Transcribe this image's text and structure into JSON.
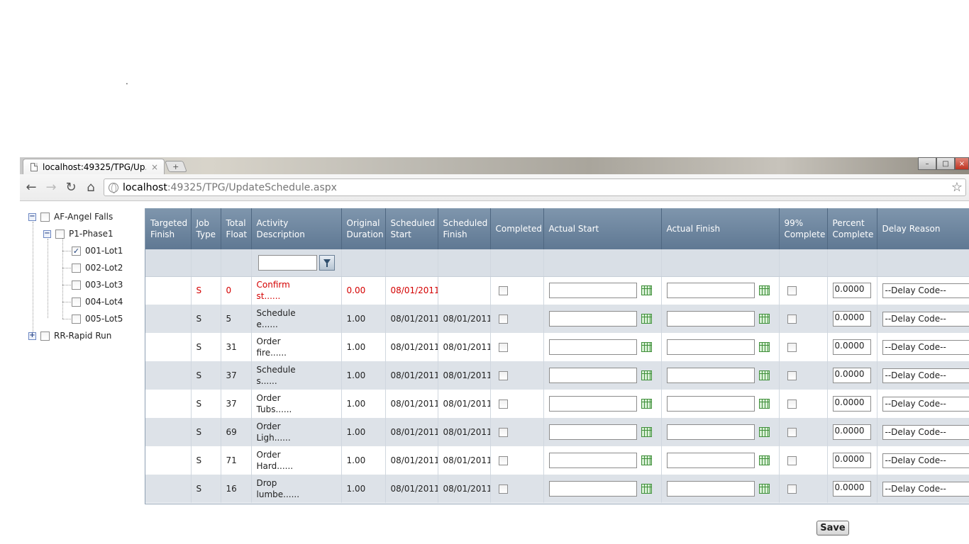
{
  "page_marker": ".",
  "browser": {
    "tab_title": "localhost:49325/TPG/Up...",
    "tab_close": "×",
    "new_tab": "+",
    "url_host": "localhost",
    "url_rest": ":49325/TPG/UpdateSchedule.aspx",
    "window_controls": [
      "–",
      "□",
      "×"
    ]
  },
  "tree": [
    {
      "label": "AF-Angel Falls",
      "expander": "−",
      "checked": false
    },
    {
      "label": "P1-Phase1",
      "expander": "−",
      "checked": false
    },
    {
      "label": "001-Lot1",
      "checked": true
    },
    {
      "label": "002-Lot2",
      "checked": false
    },
    {
      "label": "003-Lot3",
      "checked": false
    },
    {
      "label": "004-Lot4",
      "checked": false
    },
    {
      "label": "005-Lot5",
      "checked": false
    },
    {
      "label": "RR-Rapid Run",
      "expander": "+",
      "checked": false
    }
  ],
  "grid": {
    "columns": [
      "Targeted Finish",
      "Job Type",
      "Total Float",
      "Activity Description",
      "Original Duration",
      "Scheduled Start",
      "Scheduled Finish",
      "Completed",
      "Actual Start",
      "Actual Finish",
      "99% Complete",
      "Percent Complete",
      "Delay Reason"
    ],
    "delay_placeholder": "--Delay Code--",
    "rows": [
      {
        "targeted_finish": "",
        "job_type": "S",
        "total_float": "0",
        "desc1": "Confirm",
        "desc2": "st......",
        "orig_duration": "0.00",
        "sched_start": "08/01/2011",
        "sched_finish": "",
        "percent": "0.0000",
        "critical": true
      },
      {
        "targeted_finish": "",
        "job_type": "S",
        "total_float": "5",
        "desc1": "Schedule",
        "desc2": "e......",
        "orig_duration": "1.00",
        "sched_start": "08/01/2011",
        "sched_finish": "08/01/2011",
        "percent": "0.0000",
        "critical": false
      },
      {
        "targeted_finish": "",
        "job_type": "S",
        "total_float": "31",
        "desc1": "Order",
        "desc2": "fire......",
        "orig_duration": "1.00",
        "sched_start": "08/01/2011",
        "sched_finish": "08/01/2011",
        "percent": "0.0000",
        "critical": false
      },
      {
        "targeted_finish": "",
        "job_type": "S",
        "total_float": "37",
        "desc1": "Schedule",
        "desc2": "s......",
        "orig_duration": "1.00",
        "sched_start": "08/01/2011",
        "sched_finish": "08/01/2011",
        "percent": "0.0000",
        "critical": false
      },
      {
        "targeted_finish": "",
        "job_type": "S",
        "total_float": "37",
        "desc1": "Order",
        "desc2": "Tubs......",
        "orig_duration": "1.00",
        "sched_start": "08/01/2011",
        "sched_finish": "08/01/2011",
        "percent": "0.0000",
        "critical": false
      },
      {
        "targeted_finish": "",
        "job_type": "S",
        "total_float": "69",
        "desc1": "Order",
        "desc2": "Ligh......",
        "orig_duration": "1.00",
        "sched_start": "08/01/2011",
        "sched_finish": "08/01/2011",
        "percent": "0.0000",
        "critical": false
      },
      {
        "targeted_finish": "",
        "job_type": "S",
        "total_float": "71",
        "desc1": "Order",
        "desc2": "Hard......",
        "orig_duration": "1.00",
        "sched_start": "08/01/2011",
        "sched_finish": "08/01/2011",
        "percent": "0.0000",
        "critical": false
      },
      {
        "targeted_finish": "",
        "job_type": "S",
        "total_float": "16",
        "desc1": "Drop",
        "desc2": "lumbe......",
        "orig_duration": "1.00",
        "sched_start": "08/01/2011",
        "sched_finish": "08/01/2011",
        "percent": "0.0000",
        "critical": false
      }
    ]
  },
  "save_label": "Save",
  "colors": {
    "header": "#6d849c",
    "alt_row": "#dde2e8",
    "critical_text": "#d40000",
    "calendar_icon": "#3f8f3a"
  }
}
